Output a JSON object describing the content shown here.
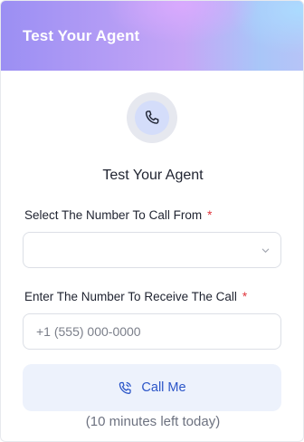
{
  "header": {
    "title": "Test Your Agent"
  },
  "hero": {
    "icon": "phone-icon",
    "title": "Test Your Agent"
  },
  "from_number": {
    "label": "Select The Number To Call From",
    "required_mark": "*",
    "selected_value": ""
  },
  "to_number": {
    "label": "Enter The Number To Receive The Call",
    "required_mark": "*",
    "placeholder": "+1 (555) 000-0000",
    "value": ""
  },
  "call_button": {
    "label": "Call Me",
    "icon": "phone-call-icon"
  },
  "minutes_left": "(10 minutes left today)",
  "colors": {
    "accent": "#2b55c8",
    "required": "#e0353c",
    "button_bg": "#edf2fc"
  }
}
